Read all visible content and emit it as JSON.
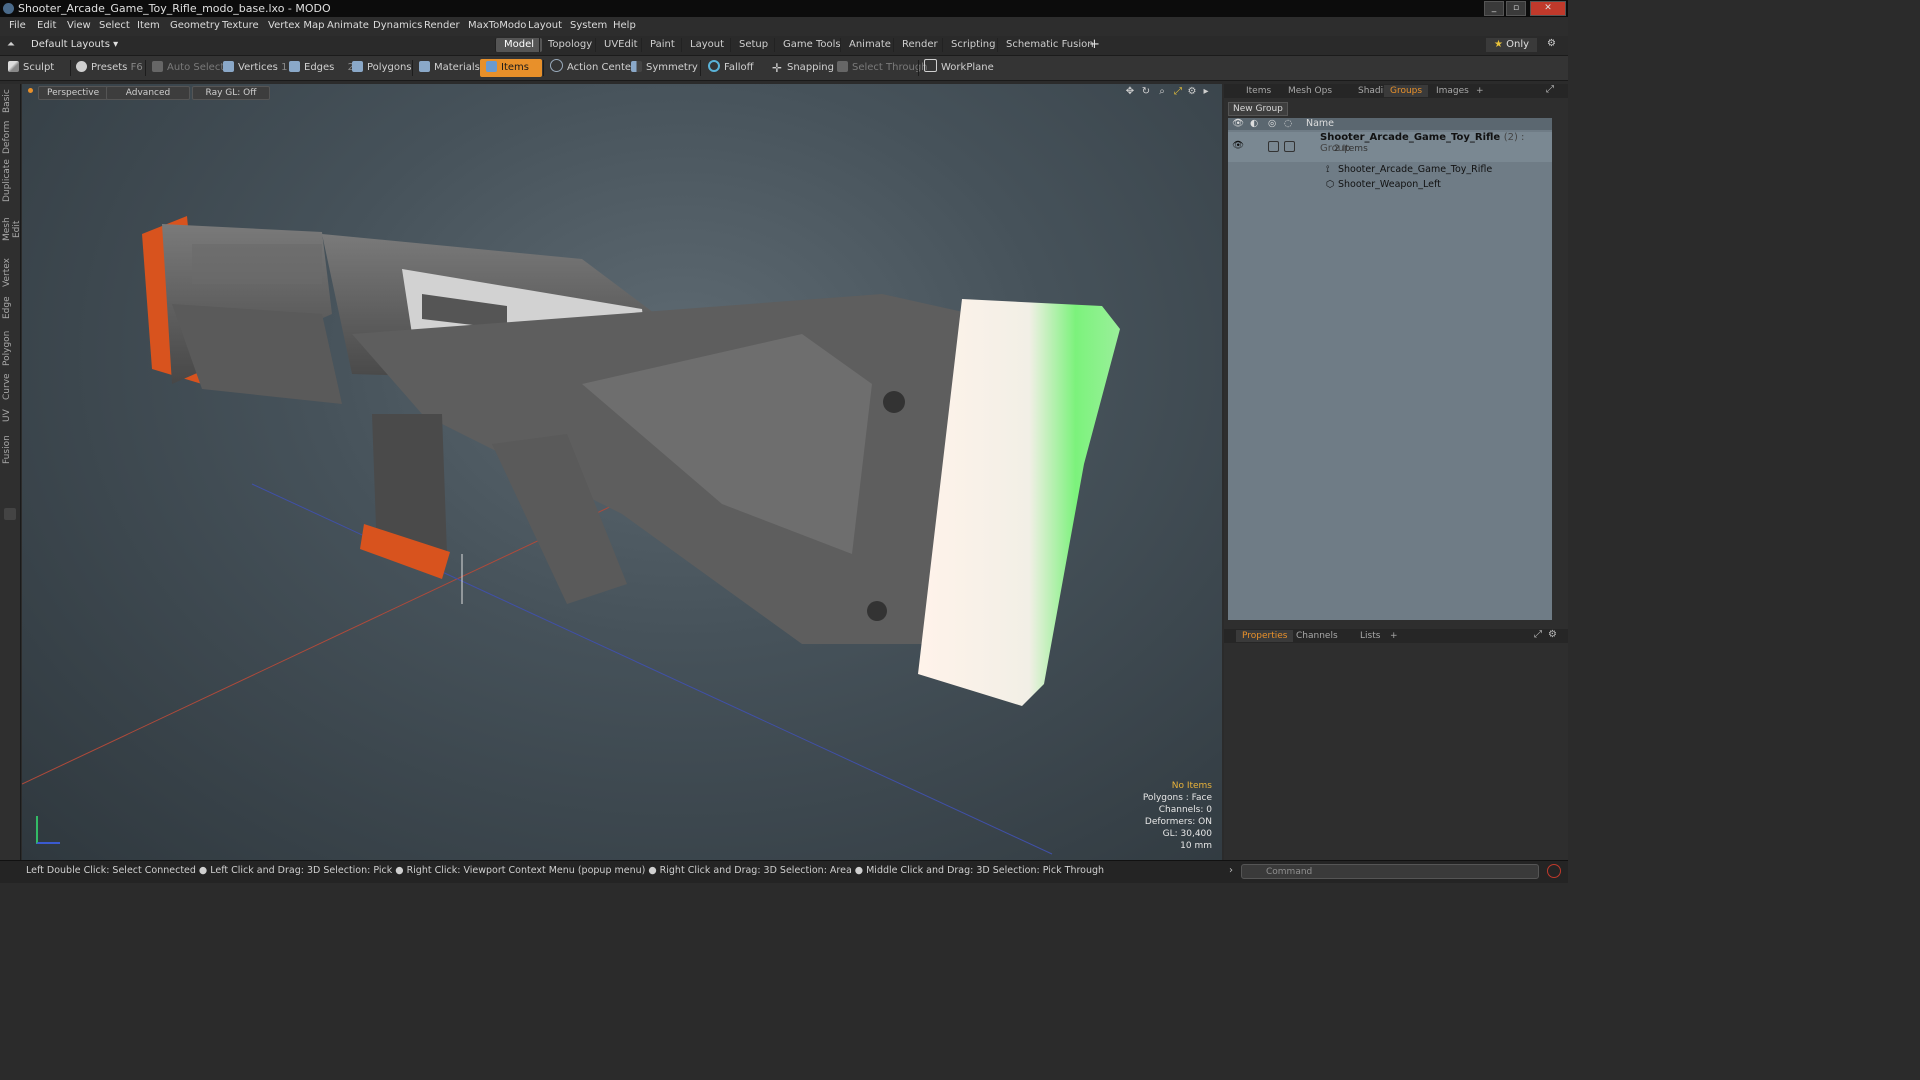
{
  "window": {
    "title": "Shooter_Arcade_Game_Toy_Rifle_modo_base.lxo - MODO",
    "min": "_",
    "max": "▫",
    "close": "✕"
  },
  "menubar": [
    "File",
    "Edit",
    "View",
    "Select",
    "Item",
    "Geometry",
    "Texture",
    "Vertex Map",
    "Animate",
    "Dynamics",
    "Render",
    "MaxToModo",
    "Layout",
    "System",
    "Help"
  ],
  "layoutbar": {
    "layouts_label": "Default Layouts",
    "tabs": [
      "Model",
      "Topology",
      "UVEdit",
      "Paint",
      "Layout",
      "Setup",
      "Game Tools",
      "Animate",
      "Render",
      "Scripting",
      "Schematic Fusion"
    ],
    "active_tab": "Model",
    "add": "+",
    "only_label": "Only"
  },
  "toolbar": {
    "sculpt": "Sculpt",
    "presets": "Presets",
    "presets_key": "F6",
    "auto_select": "Auto Select",
    "vertices": "Vertices",
    "vertices_key": "1",
    "edges": "Edges",
    "edges_key": "2",
    "polygons": "Polygons",
    "materials": "Materials",
    "items": "Items",
    "action_center": "Action Center",
    "symmetry": "Symmetry",
    "falloff": "Falloff",
    "snapping": "Snapping",
    "select_through": "Select Through",
    "workplane": "WorkPlane"
  },
  "left_tabs": [
    "Basic",
    "Deform",
    "Duplicate",
    "Mesh Edit",
    "Vertex",
    "Edge",
    "Polygon",
    "Curve",
    "UV",
    "Fusion"
  ],
  "viewport": {
    "view_mode": "Perspective",
    "shading": "Advanced",
    "raygl": "Ray GL: Off",
    "info": {
      "items": "No Items",
      "polygons": "Polygons : Face",
      "channels": "Channels: 0",
      "deformers": "Deformers: ON",
      "gl": "GL: 30,400",
      "scale": "10 mm"
    }
  },
  "right_panel": {
    "tabs": [
      "Items",
      "Mesh Ops",
      "Shading",
      "Groups",
      "Images"
    ],
    "active_tab": "Groups",
    "add": "+",
    "new_group": "New Group",
    "column_name": "Name",
    "group": {
      "name": "Shooter_Arcade_Game_Toy_Rifle",
      "suffix": "(2) : Group",
      "count": "2 Items",
      "children": [
        "Shooter_Arcade_Game_Toy_Rifle",
        "Shooter_Weapon_Left"
      ]
    },
    "bottom_tabs": [
      "Properties",
      "Channels",
      "Lists"
    ],
    "bottom_active": "Properties"
  },
  "statusbar": {
    "hint": "Left Double Click: Select Connected ● Left Click and Drag: 3D Selection: Pick ● Right Click: Viewport Context Menu (popup menu) ● Right Click and Drag: 3D Selection: Area ● Middle Click and Drag: 3D Selection: Pick Through",
    "command_placeholder": "Command"
  },
  "colors": {
    "accent": "#e8902a",
    "viewport_top": "#5e6a72",
    "selection_green": "#55ee55"
  }
}
